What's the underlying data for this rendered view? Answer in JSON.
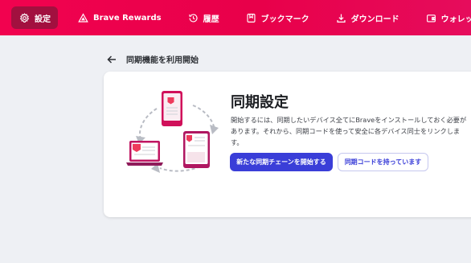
{
  "nav": {
    "tabs": [
      {
        "label": "設定",
        "icon": "gear-icon",
        "active": true
      },
      {
        "label": "Brave Rewards",
        "icon": "rewards-triangle-icon",
        "active": false
      },
      {
        "label": "履歴",
        "icon": "history-icon",
        "active": false
      },
      {
        "label": "ブックマーク",
        "icon": "bookmark-icon",
        "active": false
      },
      {
        "label": "ダウンロード",
        "icon": "download-icon",
        "active": false
      },
      {
        "label": "ウォレット",
        "icon": "wallet-icon",
        "active": false
      }
    ]
  },
  "page": {
    "back_icon": "back-arrow-icon",
    "title": "同期機能を利用開始"
  },
  "card": {
    "heading": "同期設定",
    "description": "開始するには、同期したいデバイス全てにBraveをインストールしておく必要があります。それから、同期コードを使って安全に各デバイス同士をリンクします。",
    "primary_button": "新たな同期チェーンを開始する",
    "secondary_button": "同期コードを持っています",
    "illustration": "sync-devices-illustration"
  },
  "colors": {
    "topbar": "#f1024f",
    "active_tab": "#a2103f",
    "primary": "#3a3ed8",
    "background": "#eef0f4"
  }
}
